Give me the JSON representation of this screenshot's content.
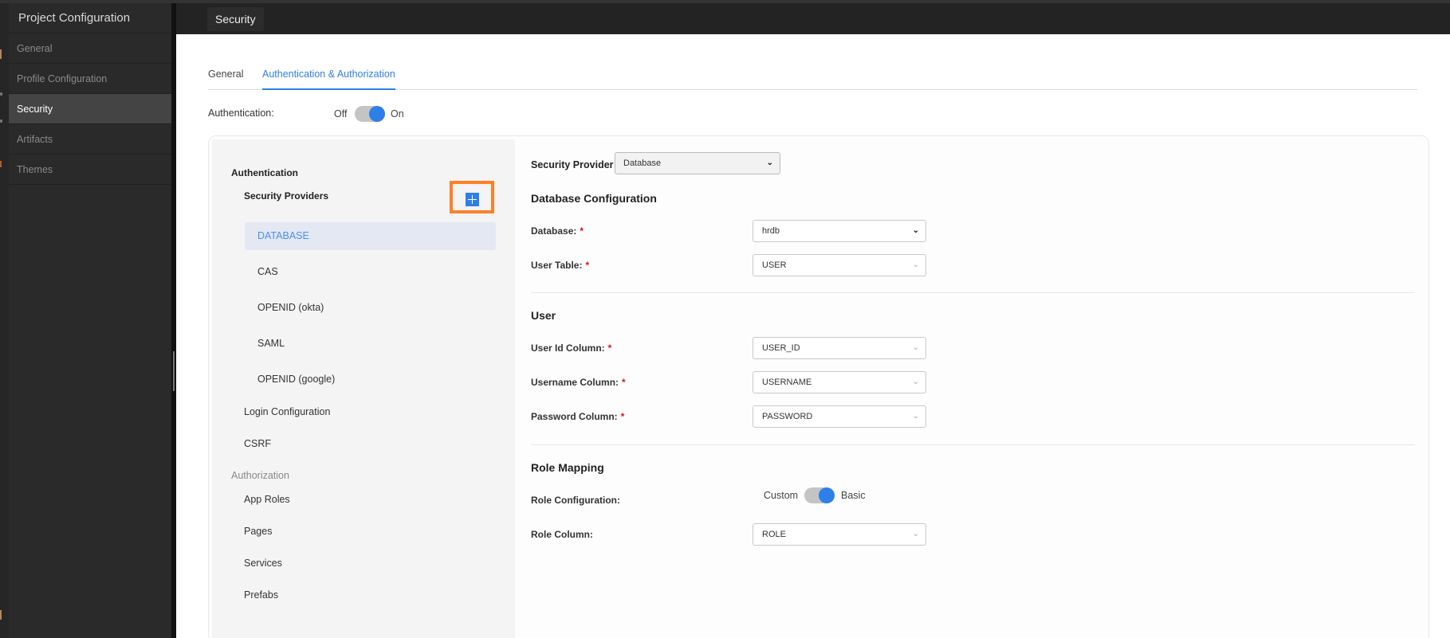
{
  "nav": {
    "title": "Project Configuration",
    "items": [
      {
        "label": "General",
        "active": false
      },
      {
        "label": "Profile Configuration",
        "active": false
      },
      {
        "label": "Security",
        "active": true
      },
      {
        "label": "Artifacts",
        "active": false
      },
      {
        "label": "Themes",
        "active": false
      }
    ]
  },
  "header": {
    "tab": "Security"
  },
  "tabs": [
    {
      "label": "General",
      "active": false
    },
    {
      "label": "Authentication & Authorization",
      "active": true
    }
  ],
  "authentication": {
    "label": "Authentication:",
    "off_label": "Off",
    "on_label": "On",
    "state": "on"
  },
  "side": {
    "authentication_heading": "Authentication",
    "security_providers_label": "Security Providers",
    "add_icon": "plus-icon",
    "providers": [
      "DATABASE",
      "CAS",
      "OPENID (okta)",
      "SAML",
      "OPENID (google)"
    ],
    "active_provider": "DATABASE",
    "login_configuration": "Login Configuration",
    "csrf": "CSRF",
    "authorization_heading": "Authorization",
    "authorization_items": [
      "App Roles",
      "Pages",
      "Services",
      "Prefabs"
    ]
  },
  "form": {
    "security_provider_label": "Security Provider",
    "security_provider_value": "Database",
    "db_config_heading": "Database Configuration",
    "database_label": "Database:",
    "database_value": "hrdb",
    "user_table_label": "User Table:",
    "user_table_value": "USER",
    "user_heading": "User",
    "user_id_label": "User Id Column:",
    "user_id_value": "USER_ID",
    "username_label": "Username Column:",
    "username_value": "USERNAME",
    "password_label": "Password Column:",
    "password_value": "PASSWORD",
    "role_heading": "Role Mapping",
    "role_config_label": "Role Configuration:",
    "role_custom_label": "Custom",
    "role_basic_label": "Basic",
    "role_config_state": "basic",
    "role_column_label": "Role Column:",
    "role_column_value": "ROLE",
    "required_marker": "*"
  },
  "colors": {
    "accent": "#2f7fe8",
    "highlight_border": "#ff7f27",
    "required": "#e01010"
  }
}
